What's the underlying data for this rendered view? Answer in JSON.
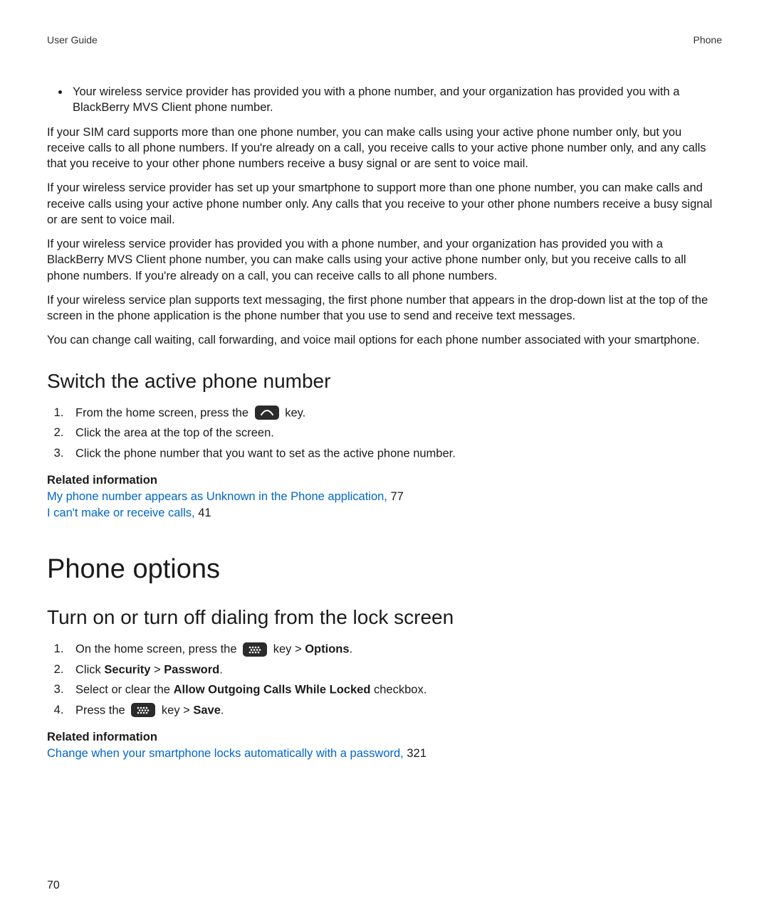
{
  "header": {
    "left": "User Guide",
    "right": "Phone"
  },
  "bullet1": "Your wireless service provider has provided you with a phone number, and your organization has provided you with a BlackBerry MVS Client phone number.",
  "p1": "If your SIM card supports more than one phone number, you can make calls using your active phone number only, but you receive calls to all phone numbers. If you're already on a call, you receive calls to your active phone number only, and any calls that you receive to your other phone numbers receive a busy signal or are sent to voice mail.",
  "p2": "If your wireless service provider has set up your smartphone to support more than one phone number, you can make calls and receive calls using your active phone number only. Any calls that you receive to your other phone numbers receive a busy signal or are sent to voice mail.",
  "p3": "If your wireless service provider has provided you with a phone number, and your organization has provided you with a BlackBerry MVS Client phone number, you can make calls using your active phone number only, but you receive calls to all phone numbers. If you're already on a call, you can receive calls to all phone numbers.",
  "p4": "If your wireless service plan supports text messaging, the first phone number that appears in the drop-down list at the top of the screen in the phone application is the phone number that you use to send and receive text messages.",
  "p5": "You can change call waiting, call forwarding, and voice mail options for each phone number associated with your smartphone.",
  "h2a": "Switch the active phone number",
  "steps_a": {
    "s1a": "From the home screen, press the ",
    "s1b": " key.",
    "s2": "Click the area at the top of the screen.",
    "s3": "Click the phone number that you want to set as the active phone number."
  },
  "related_label": "Related information",
  "link1": {
    "text": "My phone number appears as Unknown in the Phone application,",
    "page": " 77"
  },
  "link2": {
    "text": "I can't make or receive calls,",
    "page": " 41"
  },
  "h1": "Phone options",
  "h2b": "Turn on or turn off dialing from the lock screen",
  "steps_b": {
    "s1a": "On the home screen, press the ",
    "s1b": " key > ",
    "s1c": "Options",
    "s1d": ".",
    "s2a": "Click ",
    "s2b": "Security",
    "s2c": " > ",
    "s2d": "Password",
    "s2e": ".",
    "s3a": "Select or clear the ",
    "s3b": "Allow Outgoing Calls While Locked",
    "s3c": " checkbox.",
    "s4a": "Press the ",
    "s4b": " key > ",
    "s4c": "Save",
    "s4d": "."
  },
  "link3": {
    "text": "Change when your smartphone locks automatically with a password,",
    "page": " 321"
  },
  "page_number": "70"
}
